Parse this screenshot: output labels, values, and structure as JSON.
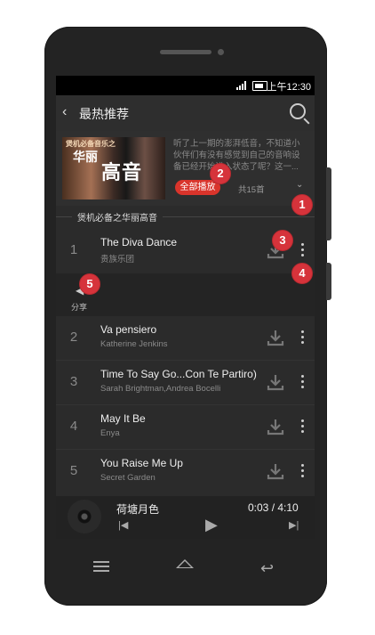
{
  "status": {
    "time": "上午12:30"
  },
  "appbar": {
    "back_icon": "chevron-left-icon",
    "title": "最热推荐",
    "search_icon": "search-icon"
  },
  "album": {
    "cover_text_1": "煲机必备音乐之",
    "cover_text_2": "华丽",
    "cover_text_3": "高音",
    "description": "听了上一期的澎湃低音，不知道小伙伴们有没有感觉到自己的音响设备已经开始进入状态了呢？这一...",
    "play_all_label": "全部播放",
    "count": "共15首",
    "expand_icon": "chevron-down-icon"
  },
  "section_title": "煲机必备之华丽高音",
  "songs": [
    {
      "num": "1",
      "title": "The Diva Dance",
      "artist": "贵族乐团"
    },
    {
      "num": "2",
      "title": "Va pensiero",
      "artist": "Katherine Jenkins"
    },
    {
      "num": "3",
      "title": "Time To Say Go...Con Te Partiro)",
      "artist": "Sarah Brightman,Andrea Bocelli"
    },
    {
      "num": "4",
      "title": "May It Be",
      "artist": "Enya"
    },
    {
      "num": "5",
      "title": "You Raise Me Up",
      "artist": "Secret Garden"
    }
  ],
  "share": {
    "label": "分享",
    "icon": "share-icon"
  },
  "player": {
    "title": "荷塘月色",
    "time": "0:03 / 4:10"
  },
  "annotations": [
    "1",
    "2",
    "3",
    "4",
    "5"
  ],
  "colors": {
    "accent": "#d9342b",
    "badge": "#d6333b",
    "background": "#2b2b2b"
  }
}
